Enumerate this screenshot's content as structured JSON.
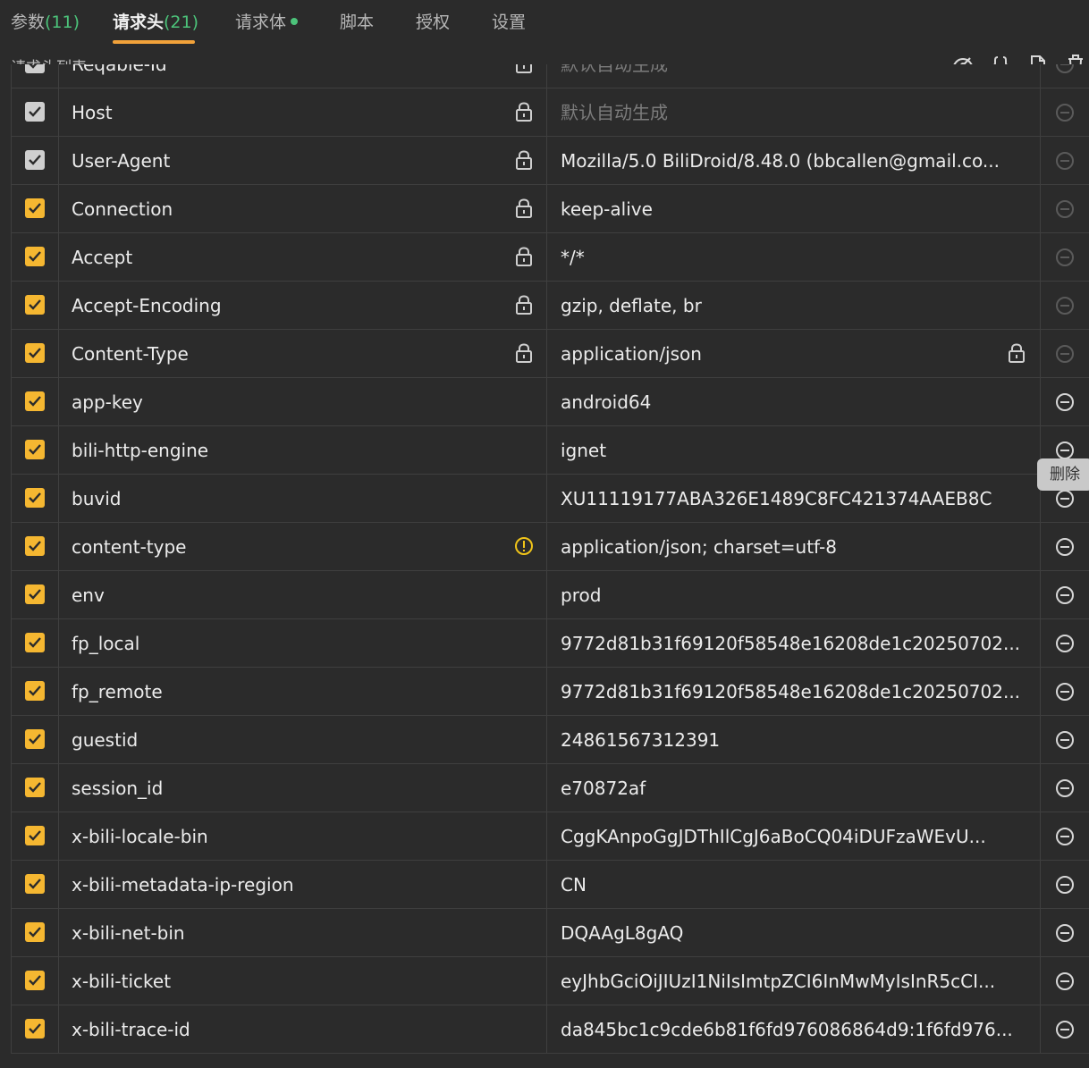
{
  "tabs": [
    {
      "label": "参数",
      "count": "(11)"
    },
    {
      "label": "请求头",
      "count": "(21)"
    },
    {
      "label": "请求体"
    },
    {
      "label": "脚本"
    },
    {
      "label": "授权"
    },
    {
      "label": "设置"
    }
  ],
  "active_tab": "请求头",
  "toolbar": {
    "title": "请求头列表",
    "icons": [
      "eye-off-icon",
      "braces-icon",
      "document-icon",
      "trash-icon"
    ]
  },
  "tooltip": "删除",
  "colors": {
    "accent": "#f5b731",
    "tab_underline": "#f2a23a",
    "count_green": "#4cc37a",
    "warning": "#f0c419"
  },
  "rows": [
    {
      "enabled": true,
      "key": "Reqable-Id",
      "value": "默认自动生成",
      "key_locked": true,
      "value_locked": false,
      "value_placeholder": true,
      "warning": false,
      "removable": false,
      "system": true
    },
    {
      "enabled": true,
      "key": "Host",
      "value": "默认自动生成",
      "key_locked": true,
      "value_locked": false,
      "value_placeholder": true,
      "warning": false,
      "removable": false,
      "system": true
    },
    {
      "enabled": true,
      "key": "User-Agent",
      "value": "Mozilla/5.0 BiliDroid/8.48.0 (bbcallen@gmail.co...",
      "key_locked": true,
      "value_locked": false,
      "value_placeholder": false,
      "warning": false,
      "removable": false,
      "system": true
    },
    {
      "enabled": true,
      "key": "Connection",
      "value": "keep-alive",
      "key_locked": true,
      "value_locked": false,
      "value_placeholder": false,
      "warning": false,
      "removable": false,
      "system": false
    },
    {
      "enabled": true,
      "key": "Accept",
      "value": "*/*",
      "key_locked": true,
      "value_locked": false,
      "value_placeholder": false,
      "warning": false,
      "removable": false,
      "system": false
    },
    {
      "enabled": true,
      "key": "Accept-Encoding",
      "value": "gzip, deflate, br",
      "key_locked": true,
      "value_locked": false,
      "value_placeholder": false,
      "warning": false,
      "removable": false,
      "system": false
    },
    {
      "enabled": true,
      "key": "Content-Type",
      "value": "application/json",
      "key_locked": true,
      "value_locked": true,
      "value_placeholder": false,
      "warning": false,
      "removable": false,
      "system": false
    },
    {
      "enabled": true,
      "key": "app-key",
      "value": "android64",
      "key_locked": false,
      "value_locked": false,
      "value_placeholder": false,
      "warning": false,
      "removable": true,
      "system": false
    },
    {
      "enabled": true,
      "key": "bili-http-engine",
      "value": "ignet",
      "key_locked": false,
      "value_locked": false,
      "value_placeholder": false,
      "warning": false,
      "removable": true,
      "system": false
    },
    {
      "enabled": true,
      "key": "buvid",
      "value": "XU11119177ABA326E1489C8FC421374AAEB8C",
      "key_locked": false,
      "value_locked": false,
      "value_placeholder": false,
      "warning": false,
      "removable": true,
      "system": false
    },
    {
      "enabled": true,
      "key": "content-type",
      "value": "application/json; charset=utf-8",
      "key_locked": false,
      "value_locked": false,
      "value_placeholder": false,
      "warning": true,
      "removable": true,
      "system": false
    },
    {
      "enabled": true,
      "key": "env",
      "value": "prod",
      "key_locked": false,
      "value_locked": false,
      "value_placeholder": false,
      "warning": false,
      "removable": true,
      "system": false
    },
    {
      "enabled": true,
      "key": "fp_local",
      "value": "9772d81b31f69120f58548e16208de1c20250702...",
      "key_locked": false,
      "value_locked": false,
      "value_placeholder": false,
      "warning": false,
      "removable": true,
      "system": false
    },
    {
      "enabled": true,
      "key": "fp_remote",
      "value": "9772d81b31f69120f58548e16208de1c20250702...",
      "key_locked": false,
      "value_locked": false,
      "value_placeholder": false,
      "warning": false,
      "removable": true,
      "system": false
    },
    {
      "enabled": true,
      "key": "guestid",
      "value": "24861567312391",
      "key_locked": false,
      "value_locked": false,
      "value_placeholder": false,
      "warning": false,
      "removable": true,
      "system": false
    },
    {
      "enabled": true,
      "key": "session_id",
      "value": "e70872af",
      "key_locked": false,
      "value_locked": false,
      "value_placeholder": false,
      "warning": false,
      "removable": true,
      "system": false
    },
    {
      "enabled": true,
      "key": "x-bili-locale-bin",
      "value": "CggKAnpoGgJDThIlCgJ6aBoCQ04iDUFzaWEvU...",
      "key_locked": false,
      "value_locked": false,
      "value_placeholder": false,
      "warning": false,
      "removable": true,
      "system": false
    },
    {
      "enabled": true,
      "key": "x-bili-metadata-ip-region",
      "value": "CN",
      "key_locked": false,
      "value_locked": false,
      "value_placeholder": false,
      "warning": false,
      "removable": true,
      "system": false
    },
    {
      "enabled": true,
      "key": "x-bili-net-bin",
      "value": "DQAAgL8gAQ",
      "key_locked": false,
      "value_locked": false,
      "value_placeholder": false,
      "warning": false,
      "removable": true,
      "system": false
    },
    {
      "enabled": true,
      "key": "x-bili-ticket",
      "value": "eyJhbGciOiJIUzI1NiIsImtpZCI6InMwMyIsInR5cCI...",
      "key_locked": false,
      "value_locked": false,
      "value_placeholder": false,
      "warning": false,
      "removable": true,
      "system": false
    },
    {
      "enabled": true,
      "key": "x-bili-trace-id",
      "value": "da845bc1c9cde6b81f6fd976086864d9:1f6fd976...",
      "key_locked": false,
      "value_locked": false,
      "value_placeholder": false,
      "warning": false,
      "removable": true,
      "system": false
    }
  ]
}
